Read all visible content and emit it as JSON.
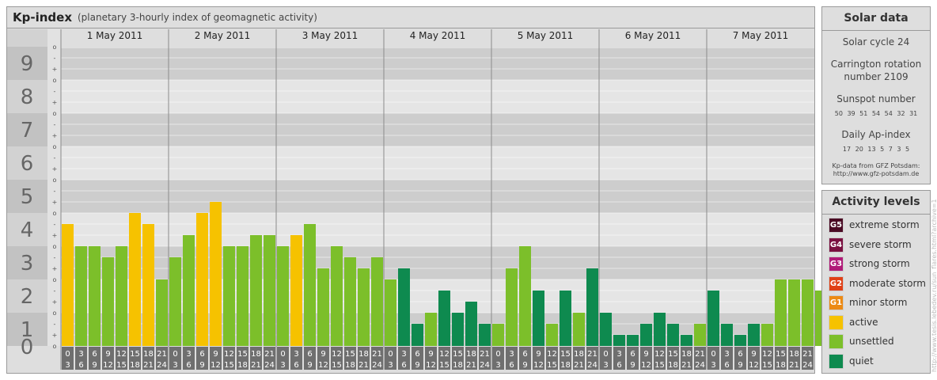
{
  "header": {
    "title": "Kp-index",
    "subtitle": "(planetary 3-hourly index of geomagnetic activity)"
  },
  "chart_data": {
    "type": "bar",
    "title": "Kp-index",
    "subtitle": "(planetary 3-hourly index of geomagnetic activity)",
    "ylim": [
      0,
      9
    ],
    "y_ticks": [
      "0",
      "1",
      "2",
      "3",
      "4",
      "5",
      "6",
      "7",
      "8",
      "9"
    ],
    "minor_tick_labels": [
      "o",
      "+",
      "-",
      "o",
      "+",
      "-",
      "o",
      "+",
      "-",
      "o",
      "+",
      "-",
      "o",
      "+",
      "-",
      "o",
      "+",
      "-",
      "o",
      "+",
      "-",
      "o",
      "+",
      "-",
      "o",
      "+",
      "-",
      "o"
    ],
    "days": [
      "1 May 2011",
      "2 May 2011",
      "3 May 2011",
      "4 May 2011",
      "5 May 2011",
      "6 May 2011",
      "7 May 2011"
    ],
    "interval_start_labels": [
      "0",
      "3",
      "6",
      "9",
      "12",
      "15",
      "18",
      "21"
    ],
    "interval_end_labels": [
      "3",
      "6",
      "9",
      "12",
      "15",
      "18",
      "21",
      "24"
    ],
    "colors": {
      "quiet": "#0e8a4f",
      "unsettled": "#7cbf2a",
      "active": "#f6c200"
    },
    "values": [
      3.667,
      3.0,
      3.0,
      2.667,
      3.0,
      4.0,
      3.667,
      2.0,
      2.667,
      3.333,
      4.0,
      4.333,
      3.0,
      3.0,
      3.333,
      3.333,
      3.0,
      3.333,
      3.667,
      2.333,
      3.0,
      2.667,
      2.333,
      2.667,
      2.0,
      2.333,
      0.667,
      1.0,
      1.667,
      1.0,
      1.333,
      0.667,
      0.667,
      2.333,
      3.0,
      1.667,
      0.667,
      1.667,
      1.0,
      2.333,
      1.0,
      0.333,
      0.333,
      0.667,
      1.0,
      0.667,
      0.333,
      0.667,
      1.667,
      0.667,
      0.333,
      0.667,
      0.667,
      2.0,
      2.0,
      2.0,
      1.667
    ],
    "levels": [
      "active",
      "unsettled",
      "unsettled",
      "unsettled",
      "unsettled",
      "active",
      "active",
      "unsettled",
      "unsettled",
      "unsettled",
      "active",
      "active",
      "unsettled",
      "unsettled",
      "unsettled",
      "unsettled",
      "unsettled",
      "active",
      "unsettled",
      "unsettled",
      "unsettled",
      "unsettled",
      "unsettled",
      "unsettled",
      "unsettled",
      "quiet",
      "quiet",
      "unsettled",
      "quiet",
      "quiet",
      "quiet",
      "quiet",
      "unsettled",
      "unsettled",
      "unsettled",
      "quiet",
      "unsettled",
      "quiet",
      "unsettled",
      "quiet",
      "quiet",
      "quiet",
      "quiet",
      "quiet",
      "quiet",
      "quiet",
      "quiet",
      "unsettled",
      "quiet",
      "quiet",
      "quiet",
      "quiet",
      "unsettled",
      "unsettled",
      "unsettled",
      "unsettled"
    ]
  },
  "solar": {
    "title": "Solar data",
    "cycle": "Solar cycle 24",
    "carrington_line1": "Carrington rotation",
    "carrington_line2": "number 2109",
    "sunspot_label": "Sunspot number",
    "sunspot_values": "50 39 51 54 54 32 31",
    "ap_label": "Daily Ap-index",
    "ap_values": "17 20 13 5 7 3 5",
    "credit_line1": "Kp-data from GFZ Potsdam:",
    "credit_line2": "http://www.gfz-potsdam.de"
  },
  "legend": {
    "title": "Activity levels",
    "items": [
      {
        "code": "G5",
        "label": "extreme storm",
        "color": "#4a0a24"
      },
      {
        "code": "G4",
        "label": "severe storm",
        "color": "#7a1040"
      },
      {
        "code": "G3",
        "label": "strong storm",
        "color": "#b01b78"
      },
      {
        "code": "G2",
        "label": "moderate storm",
        "color": "#e04016"
      },
      {
        "code": "G1",
        "label": "minor storm",
        "color": "#ec8a14"
      },
      {
        "code": "",
        "label": "active",
        "color": "#f6c200"
      },
      {
        "code": "",
        "label": "unsettled",
        "color": "#7cbf2a"
      },
      {
        "code": "",
        "label": "quiet",
        "color": "#0e8a4f"
      }
    ]
  },
  "watermark": "http://www.tesis.lebedev.ru/sun_flares.html?archive=1"
}
